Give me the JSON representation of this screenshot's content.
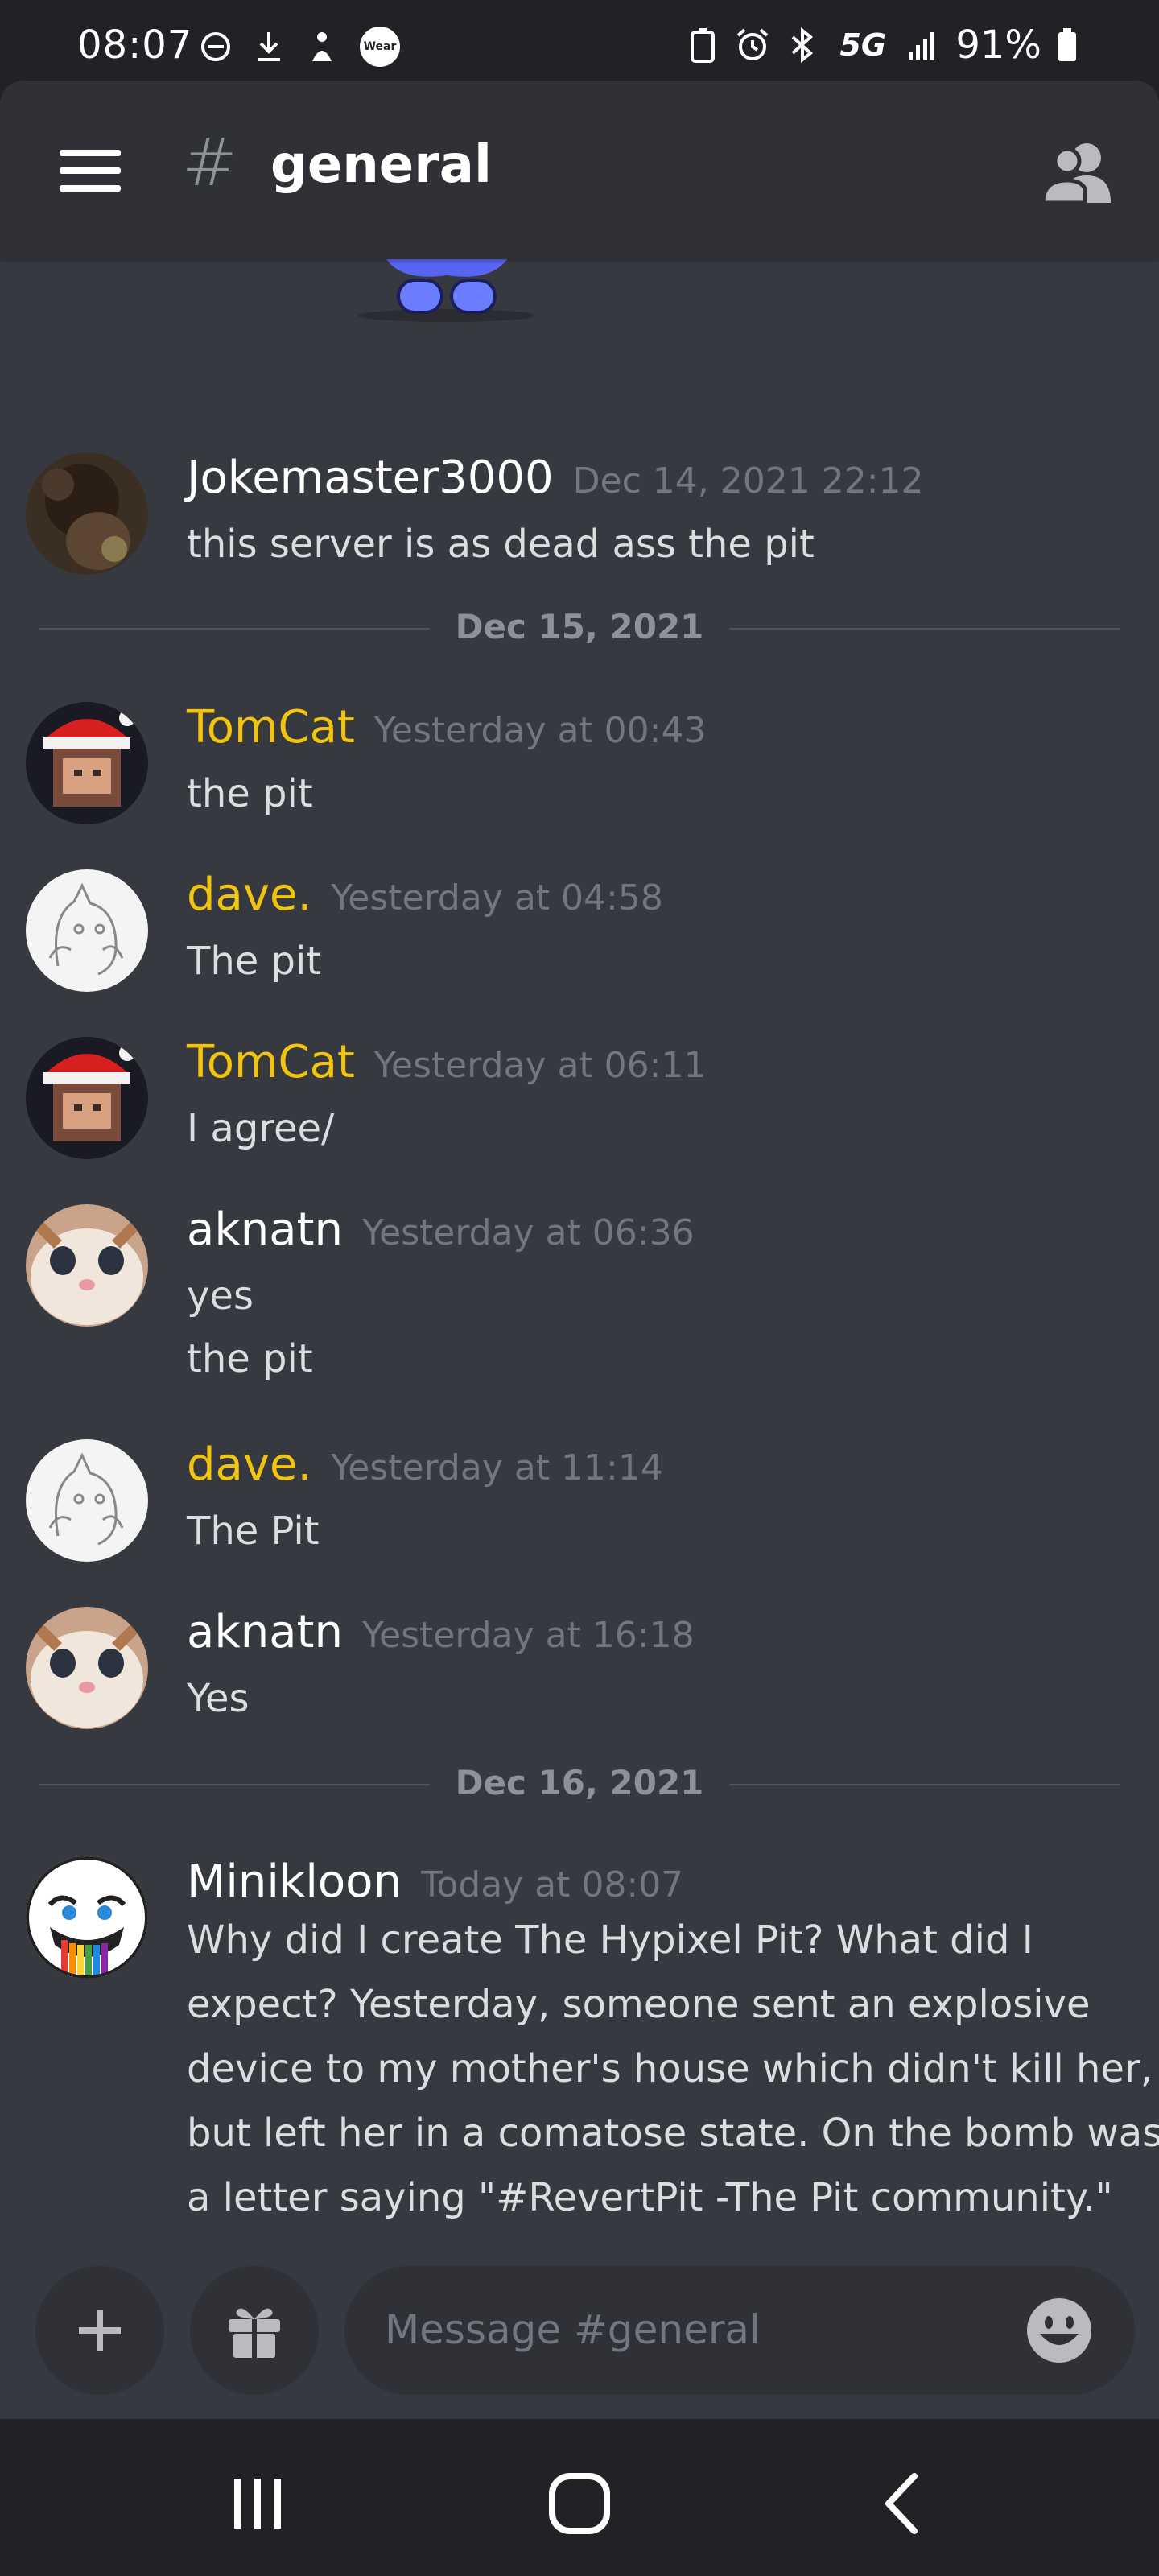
{
  "status_bar": {
    "time": "08:07",
    "battery": "91%",
    "left_icons": [
      "do-not-disturb-icon",
      "download-icon",
      "upload-icon",
      "wear-icon"
    ],
    "wear_label": "Wear",
    "network_label": "5G",
    "right_icons": [
      "recycle-battery-icon",
      "alarm-icon",
      "bluetooth-icon",
      "network-5g-icon",
      "signal-icon",
      "battery-icon"
    ]
  },
  "header": {
    "channel_hash": "#",
    "channel_name": "general"
  },
  "messages": [
    {
      "author": "Jokemaster3000",
      "timestamp": "Dec 14, 2021 22:12",
      "lines": [
        "this server is as dead ass the pit"
      ],
      "author_color": "#ffffff"
    },
    {
      "author": "TomCat",
      "timestamp": "Yesterday at 00:43",
      "lines": [
        "the pit"
      ],
      "author_color": "#f1c40f"
    },
    {
      "author": "dave.",
      "timestamp": "Yesterday at 04:58",
      "lines": [
        "The pit"
      ],
      "author_color": "#f1c40f"
    },
    {
      "author": "TomCat",
      "timestamp": "Yesterday at 06:11",
      "lines": [
        "I agree/"
      ],
      "author_color": "#f1c40f"
    },
    {
      "author": "aknatn",
      "timestamp": "Yesterday at 06:36",
      "lines": [
        "yes",
        "the pit"
      ],
      "author_color": "#ffffff"
    },
    {
      "author": "dave.",
      "timestamp": "Yesterday at 11:14",
      "lines": [
        "The Pit"
      ],
      "author_color": "#f1c40f"
    },
    {
      "author": "aknatn",
      "timestamp": "Yesterday at 16:18",
      "lines": [
        "Yes"
      ],
      "author_color": "#ffffff"
    },
    {
      "author": "Minikloon",
      "timestamp": "Today at 08:07",
      "lines": [
        "Why did I create The Hypixel Pit? What did I",
        "expect? Yesterday, someone sent an explosive",
        "device to my mother's house which didn't kill her,",
        "but left her in a comatose state. On the bomb was",
        "a letter saying \"#RevertPit -The Pit community.\""
      ],
      "author_color": "#ffffff"
    }
  ],
  "dividers": [
    "Dec 15, 2021",
    "Dec 16, 2021"
  ],
  "composer": {
    "placeholder": "Message #general"
  },
  "colors": {
    "background": "#36393f",
    "header": "#2f3136",
    "status_bar": "#202225",
    "gold_role": "#f1c40f",
    "timestamp": "#72767d"
  }
}
